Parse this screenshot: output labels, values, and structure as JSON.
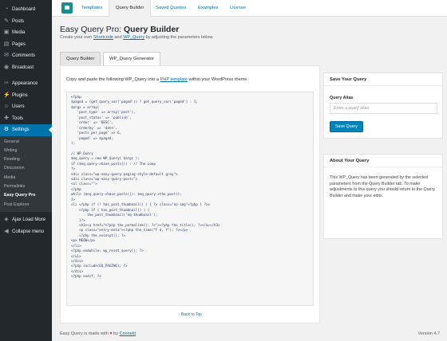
{
  "sidebar": {
    "menu_top": [
      {
        "label": "Dashboard",
        "icon": "dashboard-icon",
        "glyph": "◔"
      },
      {
        "label": "Posts",
        "icon": "pin-icon",
        "glyph": "✎"
      },
      {
        "label": "Media",
        "icon": "media-icon",
        "glyph": "▣"
      },
      {
        "label": "Pages",
        "icon": "page-icon",
        "glyph": "▤"
      },
      {
        "label": "Comments",
        "icon": "comment-icon",
        "glyph": "✉"
      },
      {
        "label": "Broadcast",
        "icon": "broadcast-icon",
        "glyph": "◉"
      }
    ],
    "menu_mid": [
      {
        "label": "Appearance",
        "icon": "brush-icon",
        "glyph": "✑"
      },
      {
        "label": "Plugins",
        "icon": "plug-icon",
        "glyph": "⚡"
      },
      {
        "label": "Users",
        "icon": "user-icon",
        "glyph": "☺"
      },
      {
        "label": "Tools",
        "icon": "wrench-icon",
        "glyph": "✚"
      }
    ],
    "settings": {
      "label": "Settings",
      "icon": "settings-icon",
      "glyph": "⚙"
    },
    "submenu": [
      "General",
      "Writing",
      "Reading",
      "Discussion",
      "Media",
      "Permalinks",
      "Easy Query Pro",
      "Post Explorer"
    ],
    "submenu_current": "Easy Query Pro",
    "menu_bottom": [
      {
        "label": "Ajax Load More",
        "icon": "load-more-icon",
        "glyph": "◈"
      },
      {
        "label": "Collapse menu",
        "icon": "collapse-icon",
        "glyph": "◀"
      }
    ]
  },
  "topnav": {
    "tabs": [
      "Templates",
      "Query Builder",
      "Saved Queries",
      "Examples",
      "License"
    ],
    "active": "Query Builder"
  },
  "page": {
    "title_prefix": "Easy Query Pro: ",
    "title_bold": "Query Builder",
    "subtitle_before": "Create your own ",
    "subtitle_link1": "Shortcode",
    "subtitle_mid": " and ",
    "subtitle_link2": "WP_Query",
    "subtitle_after": " by adjusting the parameters below."
  },
  "tabs": {
    "items": [
      "Query Builder",
      "WP_Query Generator"
    ],
    "active": "WP_Query Generator"
  },
  "generator": {
    "intro_before": "Copy and paste the following WP_Query into a ",
    "intro_link": "PHP template",
    "intro_after": " within your WordPress theme.",
    "code": [
      "<?php",
      "$paged = (get_query_var('paged')) ? get_query_var('paged') : 1;",
      "$args = array(",
      "   'post_type' => array('post'),",
      "   'post_status' => 'publish',",
      "   'order' => 'DESC',",
      "   'orderby' => 'date',",
      "   'posts_per_page' => 6,",
      "   'paged' => $paged,",
      ");",
      "",
      "// WP_Query",
      "$eq_query = new WP_Query( $args );",
      "if ($eq_query->have_posts()) : // The Loop",
      "?>",
      "<div class=\"wp-easy-query paging-style-default grey\">",
      "<div class=\"wp-easy-query-posts\">",
      "<ul class=\"\">",
      "<?php",
      "while ($eq_query->have_posts()): $eq_query->the_post();",
      "?>",
      "<li <?php if (! has_post_thumbnail() ) { ?> class=\"no-img\"<?php } ?>>",
      "    <?php if ( has_post_thumbnail() ) {",
      "        the_post_thumbnail('eq-thumbnail');",
      "    }?>",
      "    <h3><a href=\"<?php the_permalink(); ?>\"><?php the_title(); ?></a></h3>",
      "    <p class=\"entry-meta\"><?php the_time(\"F d, Y\"); ?></p>",
      "    <?php the_excerpt(); ?>",
      "<p> MEOW</p>",
      "</li>",
      "<?php endwhile; wp_reset_query(); ?>",
      "</ul>",
      "</div>",
      "<?php include(EQ_PAGING); ?>",
      "</div>",
      "<?php endif; ?>"
    ],
    "back_to_top": "↑ Back to Top"
  },
  "save_box": {
    "title": "Save Your Query",
    "alias_label": "Query Alias",
    "alias_placeholder": "Enter a query alias",
    "alias_value": "",
    "button": "Save Query"
  },
  "about_box": {
    "title": "About Your Query",
    "text": "This WP_Query has been generated by the selected parameters from the Query Builder tab. To make adjustments to this query you should return to the Query Builder and make your edits."
  },
  "footer": {
    "text_before": "Easy Query is made with ",
    "heart": "♥",
    "text_mid": " by ",
    "link": "Connekt",
    "version": "Version 4.7"
  },
  "colors": {
    "sidebar_bg": "#23282d",
    "active_blue": "#0073aa",
    "button_blue": "#0085ba",
    "link_blue": "#0073aa",
    "code_text": "#2a3a6a",
    "heart_red": "#c9352b"
  }
}
